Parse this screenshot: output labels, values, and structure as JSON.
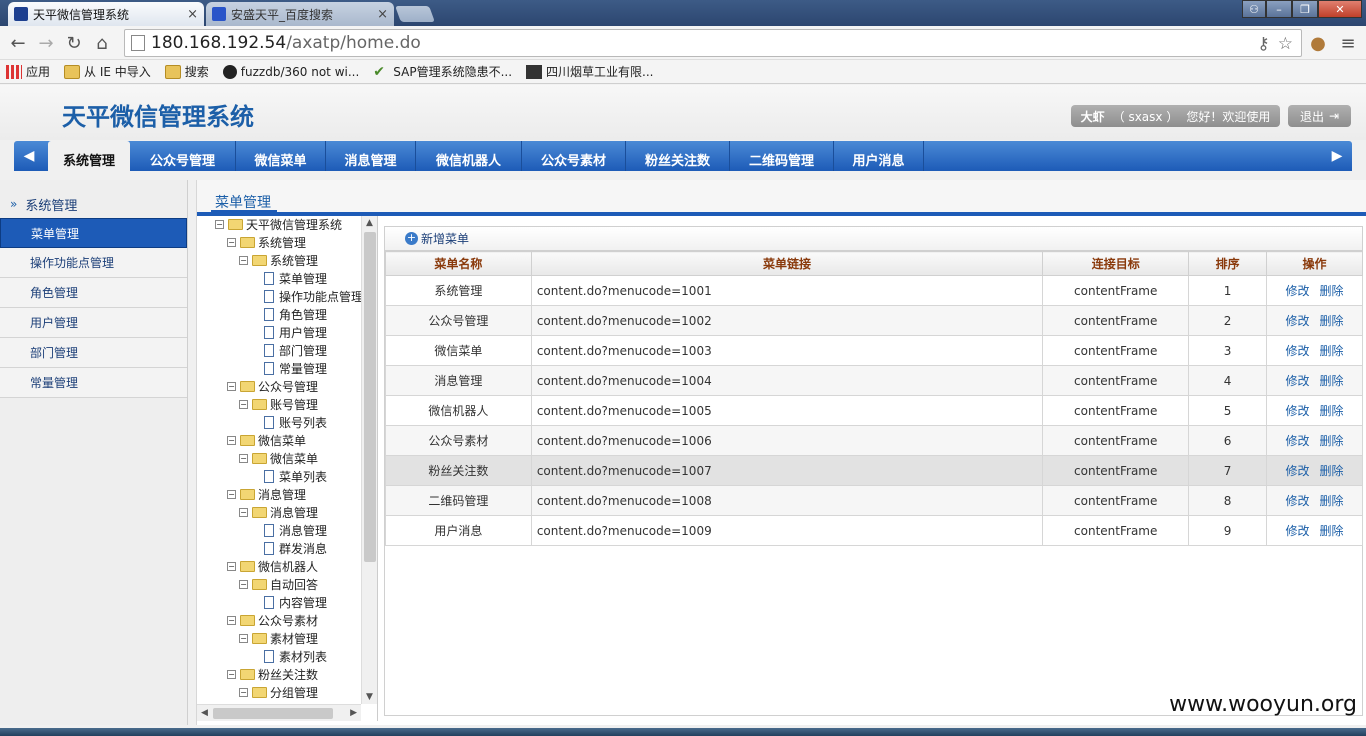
{
  "browser": {
    "tabs": [
      {
        "title": "天平微信管理系统",
        "active": true
      },
      {
        "title": "安盛天平_百度搜索",
        "active": false
      }
    ],
    "close_glyph": "×",
    "url_host": "180.168.192.54",
    "url_path": "/axatp/home.do",
    "bookmarks": [
      {
        "label": "应用",
        "icon": "apps-icon"
      },
      {
        "label": "从 IE 中导入",
        "icon": "folder-icon"
      },
      {
        "label": "搜索",
        "icon": "folder-icon"
      },
      {
        "label": "fuzzdb/360 not wi...",
        "icon": "github-icon"
      },
      {
        "label": "SAP管理系统隐患不...",
        "icon": "check-icon"
      },
      {
        "label": "四川烟草工业有限...",
        "icon": "site-icon"
      }
    ]
  },
  "app": {
    "title": "天平微信管理系统",
    "user_name": "大虾",
    "user_id": "（ sxasx ）",
    "greeting": "您好！欢迎使用",
    "logout_label": "退出",
    "menu": [
      "系统管理",
      "公众号管理",
      "微信菜单",
      "消息管理",
      "微信机器人",
      "公众号素材",
      "粉丝关注数",
      "二维码管理",
      "用户消息"
    ]
  },
  "sidebar": {
    "title": "系统管理",
    "items": [
      "菜单管理",
      "操作功能点管理",
      "角色管理",
      "用户管理",
      "部门管理",
      "常量管理"
    ]
  },
  "content": {
    "title": "菜单管理",
    "add_label": "新增菜单",
    "columns": [
      "菜单名称",
      "菜单链接",
      "连接目标",
      "排序",
      "操作"
    ],
    "rows": [
      {
        "name": "系统管理",
        "link": "content.do?menucode=1001",
        "target": "contentFrame",
        "order": "1"
      },
      {
        "name": "公众号管理",
        "link": "content.do?menucode=1002",
        "target": "contentFrame",
        "order": "2"
      },
      {
        "name": "微信菜单",
        "link": "content.do?menucode=1003",
        "target": "contentFrame",
        "order": "3"
      },
      {
        "name": "消息管理",
        "link": "content.do?menucode=1004",
        "target": "contentFrame",
        "order": "4"
      },
      {
        "name": "微信机器人",
        "link": "content.do?menucode=1005",
        "target": "contentFrame",
        "order": "5"
      },
      {
        "name": "公众号素材",
        "link": "content.do?menucode=1006",
        "target": "contentFrame",
        "order": "6"
      },
      {
        "name": "粉丝关注数",
        "link": "content.do?menucode=1007",
        "target": "contentFrame",
        "order": "7"
      },
      {
        "name": "二维码管理",
        "link": "content.do?menucode=1008",
        "target": "contentFrame",
        "order": "8"
      },
      {
        "name": "用户消息",
        "link": "content.do?menucode=1009",
        "target": "contentFrame",
        "order": "9"
      }
    ],
    "edit_label": "修改",
    "delete_label": "删除"
  },
  "tree": [
    {
      "label": "天平微信管理系统",
      "depth": 0,
      "type": "folder"
    },
    {
      "label": "系统管理",
      "depth": 1,
      "type": "folder"
    },
    {
      "label": "系统管理",
      "depth": 2,
      "type": "folder"
    },
    {
      "label": "菜单管理",
      "depth": 3,
      "type": "file"
    },
    {
      "label": "操作功能点管理",
      "depth": 3,
      "type": "file"
    },
    {
      "label": "角色管理",
      "depth": 3,
      "type": "file"
    },
    {
      "label": "用户管理",
      "depth": 3,
      "type": "file"
    },
    {
      "label": "部门管理",
      "depth": 3,
      "type": "file"
    },
    {
      "label": "常量管理",
      "depth": 3,
      "type": "file"
    },
    {
      "label": "公众号管理",
      "depth": 1,
      "type": "folder"
    },
    {
      "label": "账号管理",
      "depth": 2,
      "type": "folder"
    },
    {
      "label": "账号列表",
      "depth": 3,
      "type": "file"
    },
    {
      "label": "微信菜单",
      "depth": 1,
      "type": "folder"
    },
    {
      "label": "微信菜单",
      "depth": 2,
      "type": "folder"
    },
    {
      "label": "菜单列表",
      "depth": 3,
      "type": "file"
    },
    {
      "label": "消息管理",
      "depth": 1,
      "type": "folder"
    },
    {
      "label": "消息管理",
      "depth": 2,
      "type": "folder"
    },
    {
      "label": "消息管理",
      "depth": 3,
      "type": "file"
    },
    {
      "label": "群发消息",
      "depth": 3,
      "type": "file"
    },
    {
      "label": "微信机器人",
      "depth": 1,
      "type": "folder"
    },
    {
      "label": "自动回答",
      "depth": 2,
      "type": "folder"
    },
    {
      "label": "内容管理",
      "depth": 3,
      "type": "file"
    },
    {
      "label": "公众号素材",
      "depth": 1,
      "type": "folder"
    },
    {
      "label": "素材管理",
      "depth": 2,
      "type": "folder"
    },
    {
      "label": "素材列表",
      "depth": 3,
      "type": "file"
    },
    {
      "label": "粉丝关注数",
      "depth": 1,
      "type": "folder"
    },
    {
      "label": "分组管理",
      "depth": 2,
      "type": "folder"
    }
  ],
  "watermark": "www.wooyun.org",
  "colors": {
    "accent": "#1d5bb7",
    "title": "#1c5fa8",
    "header_text": "#8a3a0c"
  }
}
